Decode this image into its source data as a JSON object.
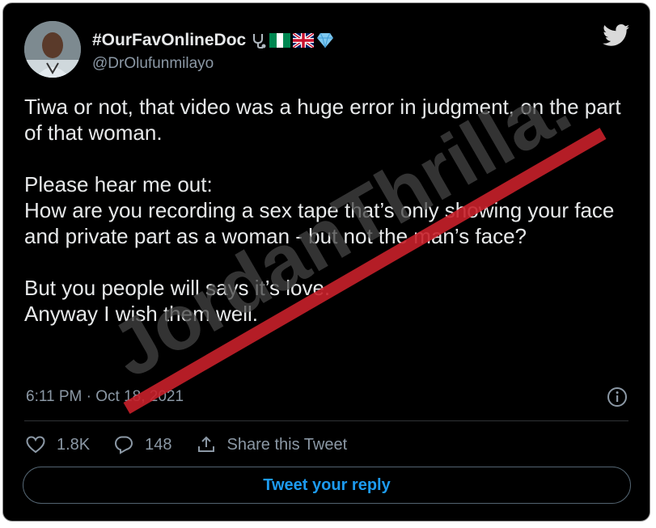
{
  "author": {
    "display_name": "#OurFavOnlineDoc",
    "handle": "@DrOlufunmilayo"
  },
  "tweet": {
    "paragraphs": [
      "Tiwa or not, that video was a huge error in judgment, on the part of that woman.",
      "Please hear me out:\nHow are you recording a sex tape that’s only showing your face and private part as a woman - but not the man’s face?",
      "But you people will says it’s love.\nAnyway I wish them well."
    ],
    "timestamp": "6:11 PM · Oct 18, 2021"
  },
  "actions": {
    "likes": "1.8K",
    "replies": "148",
    "share_label": "Share this Tweet"
  },
  "reply_button": "Tweet your reply",
  "watermark": "JordanThrilla.",
  "icons": {
    "verified_emojis": [
      "stethoscope-icon",
      "nigeria-flag-icon",
      "uk-flag-icon",
      "gem-icon"
    ],
    "brand": "twitter-bird-icon"
  },
  "colors": {
    "background": "#000000",
    "text": "#e7e9ea",
    "secondary": "#8b98a5",
    "accent": "#1d9bf0",
    "watermark_text": "#444444",
    "watermark_line": "#c8202a"
  }
}
